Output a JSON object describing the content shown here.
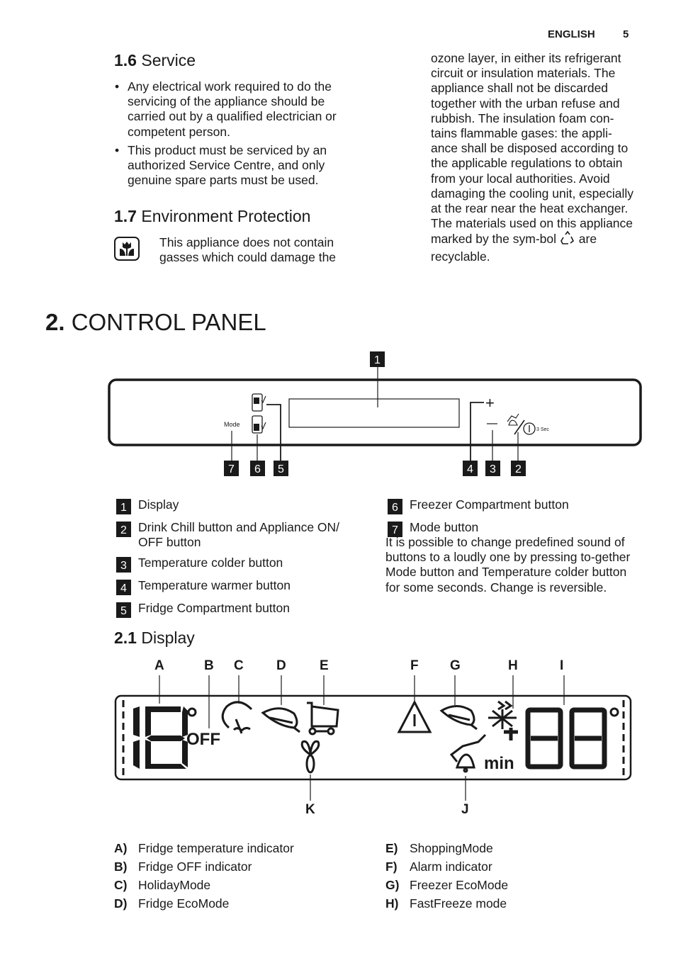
{
  "header": {
    "language": "ENGLISH",
    "page_number": "5"
  },
  "section_1_6": {
    "number": "1.6",
    "title": "Service",
    "bullets": [
      "Any electrical work required to do the servicing of the appliance should be carried out by a qualified electrician or competent person.",
      "This product must be serviced by an authorized Service Centre, and only genuine spare parts must be used."
    ]
  },
  "section_1_7": {
    "number": "1.7",
    "title": "Environment Protection",
    "icon": "eco-flower-icon",
    "text_left": "This appliance does not contain gasses which could damage the",
    "text_right_pre": "ozone layer, in either its refrigerant circuit or insulation materials. The appliance shall not be discarded together with the urban refuse and rubbish. The insulation foam con-tains flammable gases: the appli-ance shall be disposed according to the applicable regulations to obtain from your local authorities. Avoid damaging the cooling unit, especially at the rear near the heat exchanger. The materials used on this appliance marked by the sym-bol",
    "recycle_icon": "recycle-icon",
    "text_right_post": "are recyclable."
  },
  "section_2": {
    "number": "2.",
    "title": "CONTROL PANEL",
    "panel": {
      "mode_label": "Mode",
      "plus_label": "+",
      "minus_label": "–",
      "three_sec_label": "3 Sec",
      "callouts": [
        "1",
        "2",
        "3",
        "4",
        "5",
        "6",
        "7"
      ]
    },
    "legend_left": [
      {
        "n": "1",
        "label": "Display"
      },
      {
        "n": "2",
        "label": "Drink Chill button and Appliance ON/ OFF button"
      },
      {
        "n": "3",
        "label": "Temperature colder button"
      },
      {
        "n": "4",
        "label": "Temperature warmer button"
      },
      {
        "n": "5",
        "label": "Fridge Compartment button"
      }
    ],
    "legend_right": [
      {
        "n": "6",
        "label": "Freezer Compartment button"
      },
      {
        "n": "7",
        "label": "Mode button"
      }
    ],
    "note": "It is possible to change predefined sound of buttons to a loudly one by pressing to-gether Mode button and Temperature colder button for some seconds. Change is reversible."
  },
  "section_2_1": {
    "number": "2.1",
    "title": "Display",
    "display": {
      "fridge_digits": "18",
      "off_label": "OFF",
      "min_label": "min",
      "freezer_digits": "88",
      "degree": "°"
    },
    "callout_letters_top": [
      "A",
      "B",
      "C",
      "D",
      "E",
      "F",
      "G",
      "H",
      "I"
    ],
    "callout_letters_bottom": [
      "K",
      "J"
    ],
    "descriptions_left": [
      {
        "key": "A)",
        "label": "Fridge temperature indicator"
      },
      {
        "key": "B)",
        "label": "Fridge OFF indicator"
      },
      {
        "key": "C)",
        "label": "HolidayMode"
      },
      {
        "key": "D)",
        "label": "Fridge EcoMode"
      }
    ],
    "descriptions_right": [
      {
        "key": "E)",
        "label": "ShoppingMode"
      },
      {
        "key": "F)",
        "label": "Alarm indicator"
      },
      {
        "key": "G)",
        "label": "Freezer EcoMode"
      },
      {
        "key": "H)",
        "label": "FastFreeze mode"
      }
    ]
  }
}
